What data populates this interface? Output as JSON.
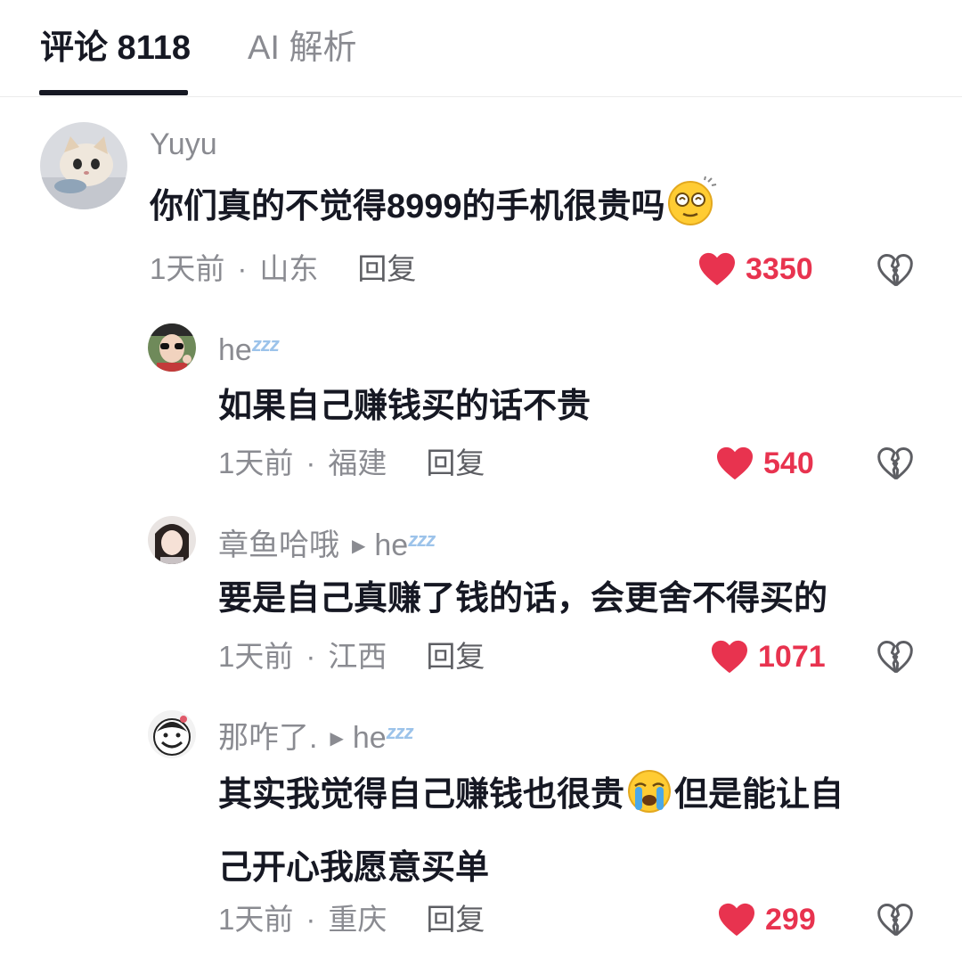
{
  "tabs": {
    "comments_label": "评论 8118",
    "ai_label": "AI 解析"
  },
  "comments": [
    {
      "user": "Yuyu",
      "text": "你们真的不觉得8999的手机很贵吗",
      "emoji": "dizzy-face-emoji",
      "time": "1天前",
      "location": "山东",
      "reply_label": "回复",
      "likes": "3350"
    },
    {
      "user": "he",
      "user_suffix": "zzz",
      "text": "如果自己赚钱买的话不贵",
      "time": "1天前",
      "location": "福建",
      "reply_label": "回复",
      "likes": "540"
    },
    {
      "user": "章鱼哈哦",
      "reply_to": "he",
      "reply_to_suffix": "zzz",
      "text": "要是自己真赚了钱的话，会更舍不得买的",
      "time": "1天前",
      "location": "江西",
      "reply_label": "回复",
      "likes": "1071"
    },
    {
      "user": "那咋了.",
      "reply_to": "he",
      "reply_to_suffix": "zzz",
      "text_part1": "其实我觉得自己赚钱也很贵",
      "emoji": "crying-face-emoji",
      "text_part2": "但是能让自",
      "text_line2": "己开心我愿意买单",
      "time": "1天前",
      "location": "重庆",
      "reply_label": "回复",
      "likes": "299"
    }
  ],
  "colors": {
    "like": "#e8334f",
    "text_primary": "#161823",
    "text_secondary": "#8a8b91",
    "zzz": "#9cc3ea"
  },
  "icons": {
    "like": "heart-icon",
    "dislike": "broken-heart-icon",
    "reply_arrow": "play-arrow-icon"
  }
}
